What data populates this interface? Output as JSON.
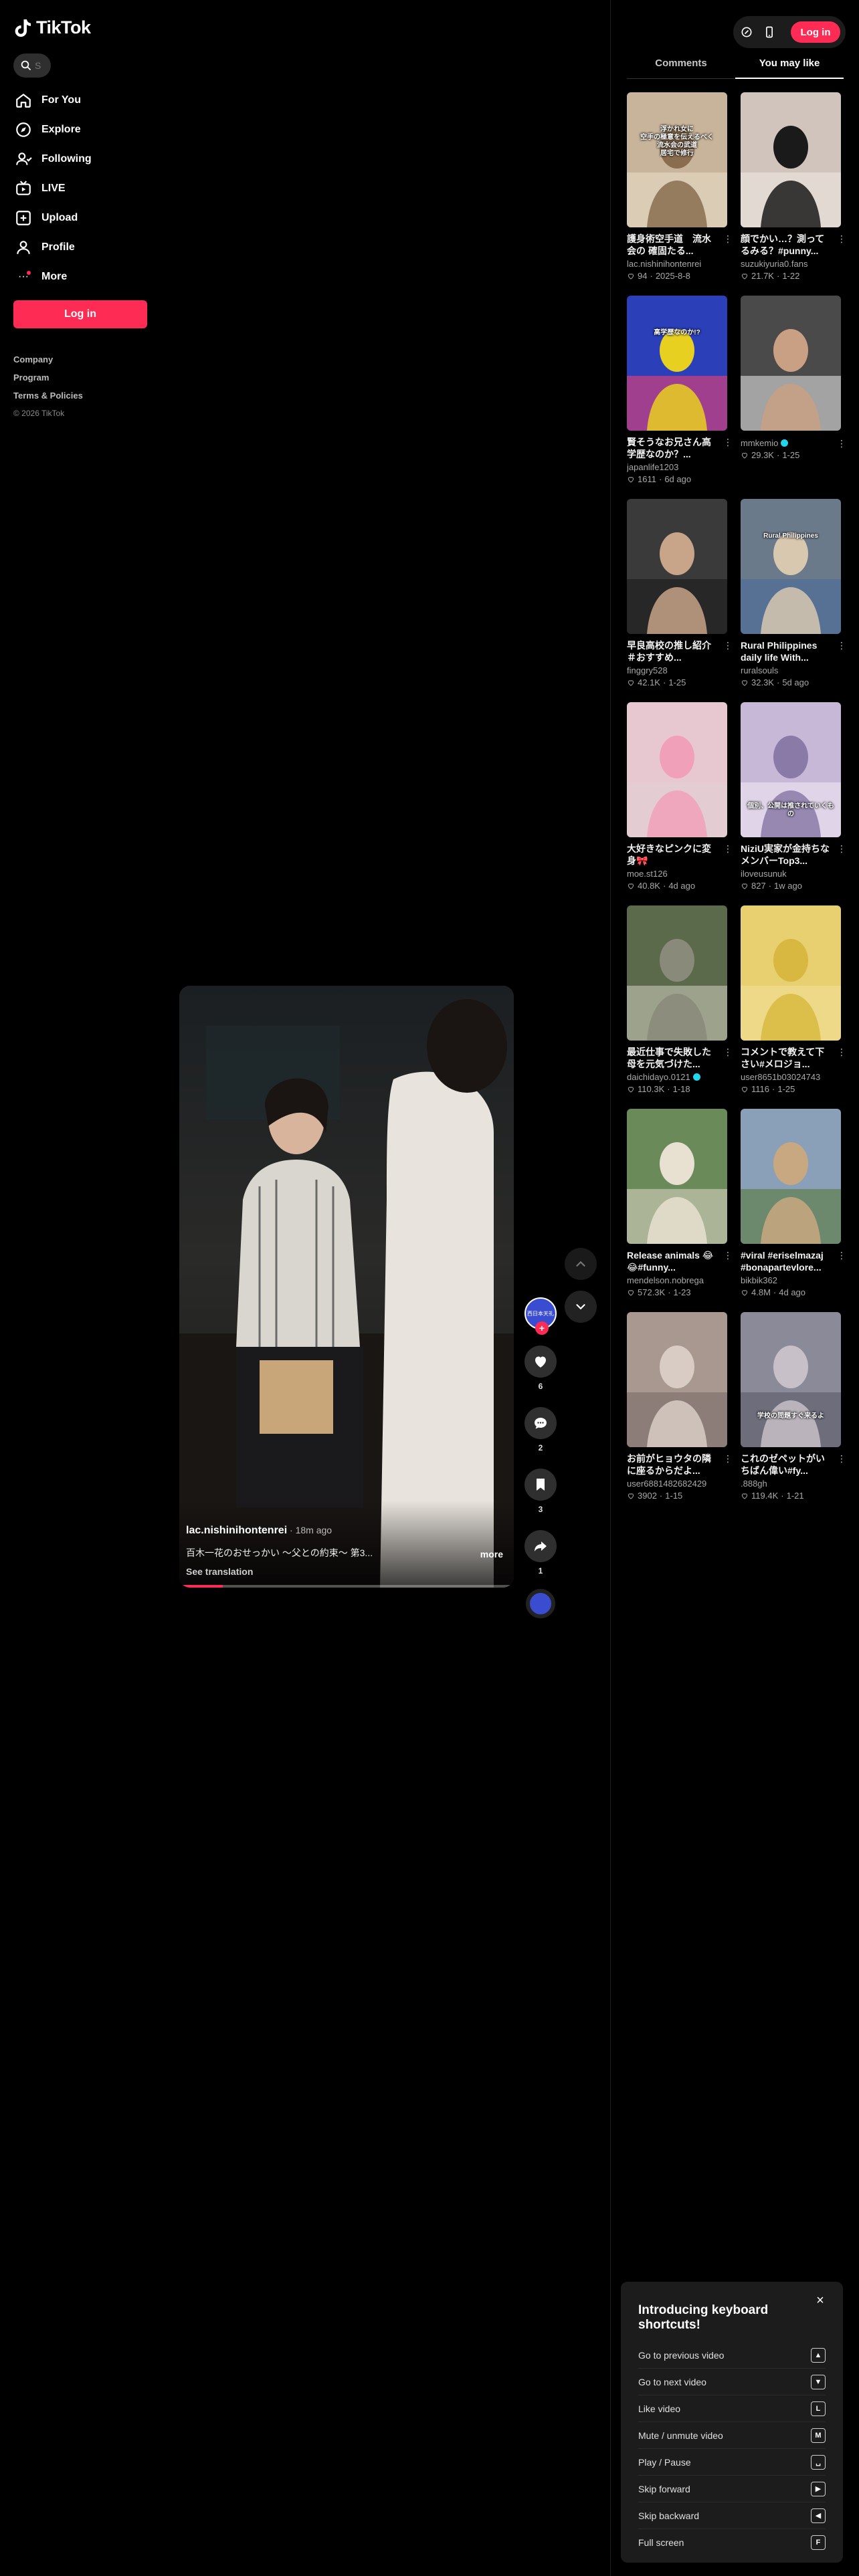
{
  "brand": {
    "name": "TikTok"
  },
  "search": {
    "placeholder": "S"
  },
  "nav": [
    {
      "label": "For You",
      "icon": "home-icon"
    },
    {
      "label": "Explore",
      "icon": "compass-icon"
    },
    {
      "label": "Following",
      "icon": "following-icon"
    },
    {
      "label": "LIVE",
      "icon": "live-icon"
    },
    {
      "label": "Upload",
      "icon": "upload-icon"
    },
    {
      "label": "Profile",
      "icon": "profile-icon"
    },
    {
      "label": "More",
      "icon": "more-icon"
    }
  ],
  "sidebar": {
    "login_label": "Log in",
    "footer": [
      "Company",
      "Program",
      "Terms & Policies"
    ],
    "copyright": "© 2026 TikTok"
  },
  "video": {
    "author": "lac.nishinihontenrei",
    "time": " · 18m ago",
    "caption": "百木一花のおせっかい ～父との約束～ 第3...",
    "more_label": "more",
    "translate_label": "See translation",
    "progress": 0.13,
    "avatar_text": "西日本天礼"
  },
  "actions": {
    "likes": "6",
    "comments": "2",
    "saves": "3",
    "shares": "1"
  },
  "topbar": {
    "login_label": "Log in"
  },
  "tabs": [
    "Comments",
    "You may like"
  ],
  "active_tab": "You may like",
  "recommended": [
    {
      "title": "護身術空手道　流水会の 確固たる...",
      "user": "lac.nishinihontenrei",
      "verified": false,
      "likes": "94",
      "age": "2025-8-8"
    },
    {
      "title": "顔でかい…？測ってるみる？#punny...",
      "user": "suzukiyuria0.fans",
      "verified": false,
      "likes": "21.7K",
      "age": "1-22"
    },
    {
      "title": "賢そうなお兄さん高学歴なのか？...",
      "user": "japanlife1203",
      "verified": false,
      "likes": "1611",
      "age": "6d ago"
    },
    {
      "title": "",
      "user": "mmkemio",
      "verified": true,
      "likes": "29.3K",
      "age": "1-25"
    },
    {
      "title": "早良高校の推し紹介＃おすすめ...",
      "user": "finggry528",
      "verified": false,
      "likes": "42.1K",
      "age": "1-25"
    },
    {
      "title": "Rural Philippines daily life With...",
      "user": "ruralsouls",
      "verified": false,
      "likes": "32.3K",
      "age": "5d ago"
    },
    {
      "title": "大好きなピンクに変身🎀",
      "user": "moe.st126",
      "verified": false,
      "likes": "40.8K",
      "age": "4d ago"
    },
    {
      "title": "NiziU実家が金持ちなメンバーTop3...",
      "user": "iloveusunuk",
      "verified": false,
      "likes": "827",
      "age": "1w ago"
    },
    {
      "title": "最近仕事で失敗した母を元気づけた...",
      "user": "daichidayo.0121",
      "verified": true,
      "likes": "110.3K",
      "age": "1-18"
    },
    {
      "title": "コメントで教えて下さい#メロジョ...",
      "user": "user8651b03024743",
      "verified": false,
      "likes": "1116",
      "age": "1-25"
    },
    {
      "title": "Release animals 😂😂#funny...",
      "user": "mendelson.nobrega",
      "verified": false,
      "likes": "572.3K",
      "age": "1-23"
    },
    {
      "title": "#viral #eriselmazaj #bonapartevlore...",
      "user": "bikbik362",
      "verified": false,
      "likes": "4.8M",
      "age": "4d ago"
    },
    {
      "title": "お前がヒョウタの隣に座るからだよ...",
      "user": "user6881482682429",
      "verified": false,
      "likes": "3902",
      "age": "1-15"
    },
    {
      "title": "これのゼペットがいちばん偉い#fy...",
      "user": ".888gh",
      "verified": false,
      "likes": "119.4K",
      "age": "1-21"
    }
  ],
  "thumb_overlays": [
    "浮かれ女に\n空手の極意を伝えるべく\n流水会の武道\n居宅で修行",
    "",
    "高学歴なのか!?",
    "",
    "",
    "Rural Philippines",
    "",
    "個別、公開は推されていくもの",
    "",
    "",
    "",
    "",
    "",
    "学校の問題すぐ来るよ"
  ],
  "shortcuts": {
    "title": "Introducing keyboard shortcuts!",
    "close": "×",
    "items": [
      {
        "label": "Go to previous video",
        "key": "▲"
      },
      {
        "label": "Go to next video",
        "key": "▼"
      },
      {
        "label": "Like video",
        "key": "L"
      },
      {
        "label": "Mute / unmute video",
        "key": "M"
      },
      {
        "label": "Play / Pause",
        "key": "␣"
      },
      {
        "label": "Skip forward",
        "key": "▶"
      },
      {
        "label": "Skip backward",
        "key": "◀"
      },
      {
        "label": "Full screen",
        "key": "F"
      }
    ]
  },
  "colors": {
    "accent": "#fe2c55",
    "background": "#000000",
    "verified": "#20d5ec"
  }
}
